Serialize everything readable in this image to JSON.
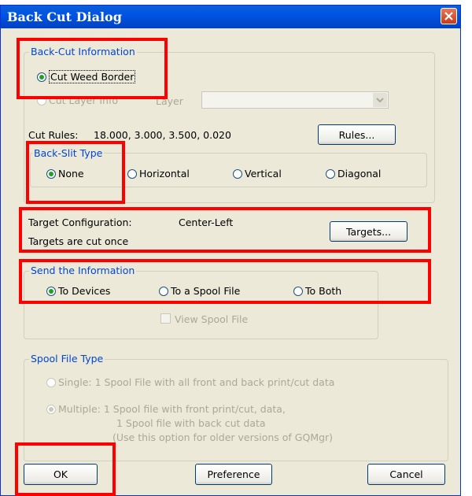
{
  "window": {
    "title": "Back Cut Dialog"
  },
  "back_cut_info": {
    "legend": "Back-Cut Information",
    "cut_weed_border": "Cut Weed Border",
    "cut_layer_info": "Cut Layer Info",
    "layer_label": "Layer",
    "layer_value": "",
    "cut_rules_label": "Cut Rules:",
    "cut_rules_values": "18.000, 3.000, 3.500, 0.020",
    "rules_button": "Rules..."
  },
  "back_slit": {
    "legend": "Back-Slit Type",
    "options": [
      "None",
      "Horizontal",
      "Vertical",
      "Diagonal"
    ],
    "selected": "None"
  },
  "targets": {
    "config_label": "Target Configuration:",
    "config_value": "Center-Left",
    "cut_note": "Targets are cut once",
    "button": "Targets..."
  },
  "send": {
    "legend": "Send the Information",
    "options": [
      "To Devices",
      "To a Spool File",
      "To Both"
    ],
    "selected": "To Devices",
    "view_spool": "View Spool File"
  },
  "spool_type": {
    "legend": "Spool File Type",
    "single": "Single:  1 Spool File with all front and back print/cut data",
    "multiple_line1": "Multiple: 1 Spool file with front print/cut, data,",
    "multiple_line2": "1 Spool file with back cut data",
    "multiple_line3": "(Use this option for older versions of GQMgr)",
    "selected": "Multiple"
  },
  "buttons": {
    "ok": "OK",
    "preference": "Preference",
    "cancel": "Cancel"
  },
  "colors": {
    "title_bar": "#0054e3",
    "group_legend": "#0046d5",
    "highlight": "#ff0000",
    "dialog_bg": "#ece9d8"
  }
}
